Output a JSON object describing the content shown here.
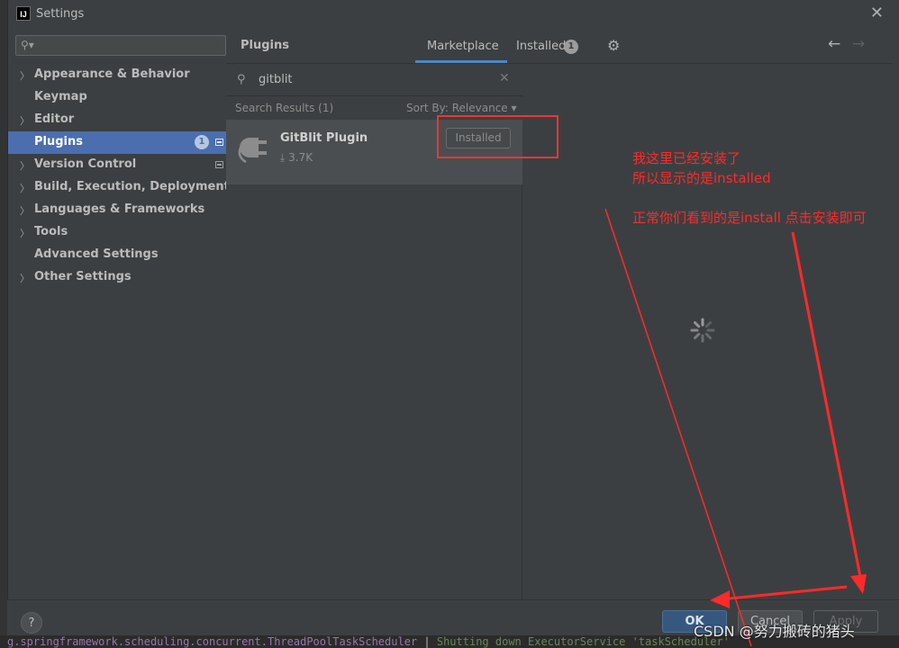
{
  "window": {
    "title": "Settings",
    "logo_text": "IJ"
  },
  "sidebar": {
    "search_placeholder": "",
    "items": [
      {
        "label": "Appearance & Behavior",
        "expandable": true
      },
      {
        "label": "Keymap",
        "expandable": false
      },
      {
        "label": "Editor",
        "expandable": true
      },
      {
        "label": "Plugins",
        "expandable": false,
        "selected": true,
        "badge": "1"
      },
      {
        "label": "Version Control",
        "expandable": true
      },
      {
        "label": "Build, Execution, Deployment",
        "expandable": true
      },
      {
        "label": "Languages & Frameworks",
        "expandable": true
      },
      {
        "label": "Tools",
        "expandable": true
      },
      {
        "label": "Advanced Settings",
        "expandable": false
      },
      {
        "label": "Other Settings",
        "expandable": true
      }
    ]
  },
  "header": {
    "title": "Plugins",
    "tabs": [
      {
        "label": "Marketplace",
        "active": true
      },
      {
        "label": "Installed",
        "badge": "1"
      }
    ]
  },
  "search": {
    "query": "gitblit",
    "results_label": "Search Results (1)",
    "sort_label": "Sort By: Relevance ▾"
  },
  "plugins": [
    {
      "name": "GitBlit Plugin",
      "downloads": "⤓ 3.7K",
      "action_label": "Installed"
    }
  ],
  "annotations": {
    "line1": "我这里已经安装了",
    "line2": "所以显示的是installed",
    "line3": "正常你们看到的是install 点击安装即可"
  },
  "footer": {
    "help_label": "?",
    "ok_label": "OK",
    "cancel_label": "Cancel",
    "apply_label": "Apply"
  },
  "background": {
    "code_class": "g.springframework.scheduling.concurrent.ThreadPoolTaskScheduler",
    "code_sep": " | ",
    "code_msg": "Shutting down ExecutorService 'taskScheduler'"
  },
  "watermark": "CSDN @努力搬砖的猪头",
  "colors": {
    "selection": "#4b6eaf",
    "accent": "#4a88c7",
    "annotation": "#ff2a2a"
  }
}
